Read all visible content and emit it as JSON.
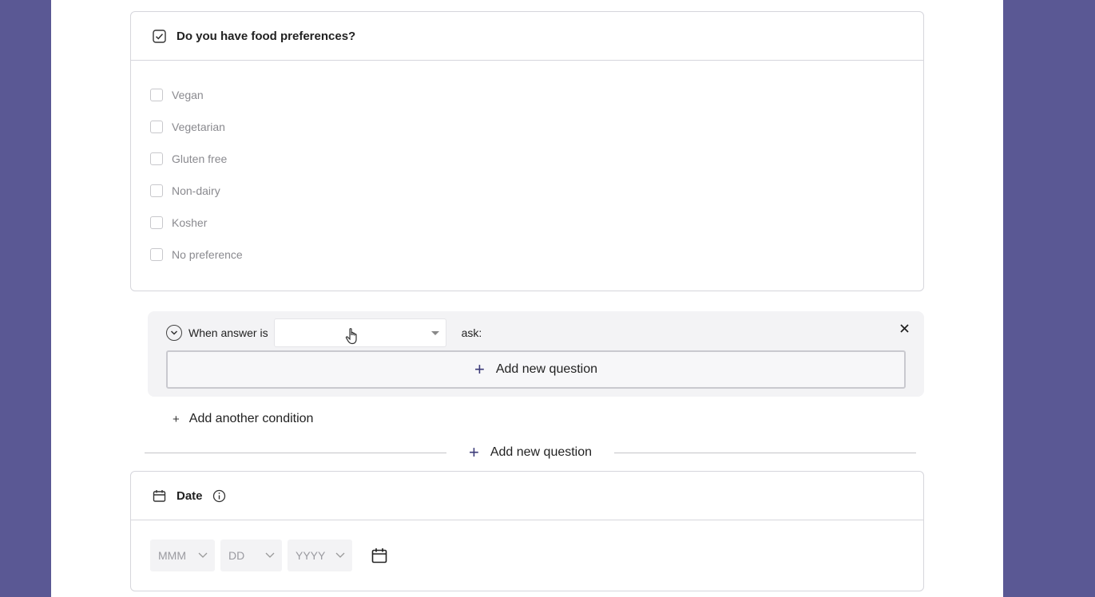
{
  "question1": {
    "title": "Do you have food preferences?",
    "icon": "checkbox-checked-icon",
    "options": [
      {
        "label": "Vegan",
        "checked": false
      },
      {
        "label": "Vegetarian",
        "checked": false
      },
      {
        "label": "Gluten free",
        "checked": false
      },
      {
        "label": "Non-dairy",
        "checked": false
      },
      {
        "label": "Kosher",
        "checked": false
      },
      {
        "label": "No preference",
        "checked": false
      }
    ]
  },
  "condition": {
    "when_label": "When answer is",
    "select_value": "",
    "ask_label": "ask:",
    "add_question_label": "Add new question"
  },
  "add_condition_label": "Add another condition",
  "divider_add_question_label": "Add new question",
  "question2": {
    "title": "Date",
    "icon": "calendar-icon",
    "month_placeholder": "MMM",
    "day_placeholder": "DD",
    "year_placeholder": "YYYY"
  },
  "colors": {
    "background": "#5a5894",
    "accent": "#3b3a78"
  }
}
